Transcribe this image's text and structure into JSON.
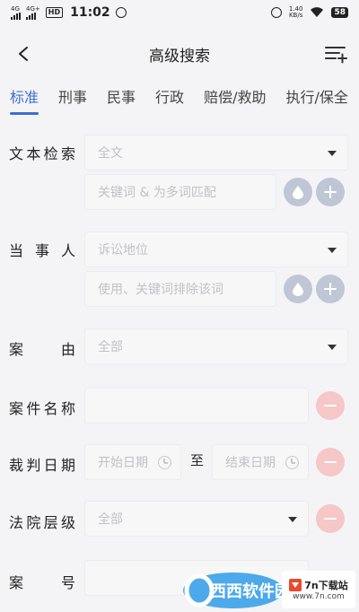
{
  "status": {
    "signal1": "4G",
    "signal2": "4G+",
    "hd": "HD",
    "time": "11:02",
    "speed_value": "1.40",
    "speed_unit": "KB/s",
    "battery": "58"
  },
  "header": {
    "title": "高级搜索"
  },
  "tabs": [
    {
      "label": "标准",
      "active": true
    },
    {
      "label": "刑事"
    },
    {
      "label": "民事"
    },
    {
      "label": "行政"
    },
    {
      "label": "赔偿/救助"
    },
    {
      "label": "执行/保全"
    }
  ],
  "form": {
    "fulltext": {
      "label": [
        "文",
        "本",
        "检",
        "索"
      ],
      "select_placeholder": "全文",
      "keyword_placeholder": "关键词 & 为多词匹配"
    },
    "party": {
      "label": [
        "当",
        "事",
        "人"
      ],
      "select_placeholder": "诉讼地位",
      "keyword_placeholder": "使用、关键词排除该词"
    },
    "cause": {
      "label": [
        "案",
        "由"
      ],
      "select_value": "全部"
    },
    "case_name": {
      "label": [
        "案",
        "件",
        "名",
        "称"
      ],
      "value": ""
    },
    "judgment_date": {
      "label": [
        "裁",
        "判",
        "日",
        "期"
      ],
      "start_placeholder": "开始日期",
      "to": "至",
      "end_placeholder": "结束日期"
    },
    "court_level": {
      "label": [
        "法",
        "院",
        "层",
        "级"
      ],
      "select_value": "全部"
    },
    "case_number": {
      "label": [
        "案",
        "号"
      ],
      "value": ""
    }
  },
  "watermark": {
    "logo_text": "西西软件园",
    "badge_title": "7n下载站",
    "badge_url": "www.7n.com"
  },
  "colors": {
    "accent": "#3b6fd4",
    "blue_btn": "#bfc6d5",
    "red_btn": "#f5c7c7"
  }
}
